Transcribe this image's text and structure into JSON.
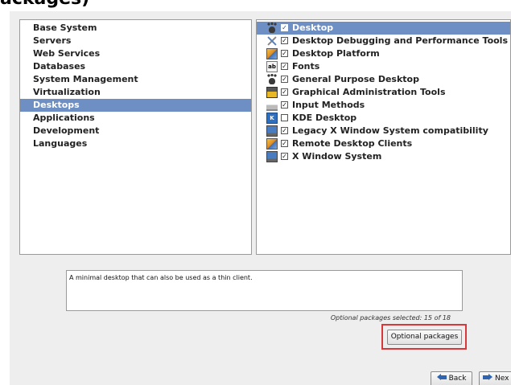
{
  "header": {
    "cut_text": "ackages)"
  },
  "categories": {
    "items": [
      {
        "label": "Base System"
      },
      {
        "label": "Servers"
      },
      {
        "label": "Web Services"
      },
      {
        "label": "Databases"
      },
      {
        "label": "System Management"
      },
      {
        "label": "Virtualization"
      },
      {
        "label": "Desktops",
        "selected": true
      },
      {
        "label": "Applications"
      },
      {
        "label": "Development"
      },
      {
        "label": "Languages"
      }
    ]
  },
  "groups": {
    "items": [
      {
        "label": "Desktop",
        "checked": true,
        "icon": "gnome-foot-icon",
        "selected": true
      },
      {
        "label": "Desktop Debugging and Performance Tools",
        "checked": true,
        "icon": "tools-icon"
      },
      {
        "label": "Desktop Platform",
        "checked": true,
        "icon": "platform-icon"
      },
      {
        "label": "Fonts",
        "checked": true,
        "icon": "fonts-icon"
      },
      {
        "label": "General Purpose Desktop",
        "checked": true,
        "icon": "gnome-foot-icon"
      },
      {
        "label": "Graphical Administration Tools",
        "checked": true,
        "icon": "admin-tools-icon"
      },
      {
        "label": "Input Methods",
        "checked": true,
        "icon": "keyboard-icon"
      },
      {
        "label": "KDE Desktop",
        "checked": false,
        "icon": "kde-icon"
      },
      {
        "label": "Legacy X Window System compatibility",
        "checked": true,
        "icon": "monitor-icon"
      },
      {
        "label": "Remote Desktop Clients",
        "checked": true,
        "icon": "remote-desktop-icon"
      },
      {
        "label": "X Window System",
        "checked": true,
        "icon": "monitor-icon"
      }
    ]
  },
  "description": {
    "text": "A minimal desktop that can also be used as a thin client."
  },
  "optional": {
    "status": "Optional packages selected: 15 of 18",
    "button_label": "Optional packages"
  },
  "nav": {
    "back_label": "Back",
    "next_label": "Nex"
  },
  "colors": {
    "selection": "#6d8fc4",
    "highlight_box": "#d9383a",
    "window_bg": "#eeeeee"
  }
}
